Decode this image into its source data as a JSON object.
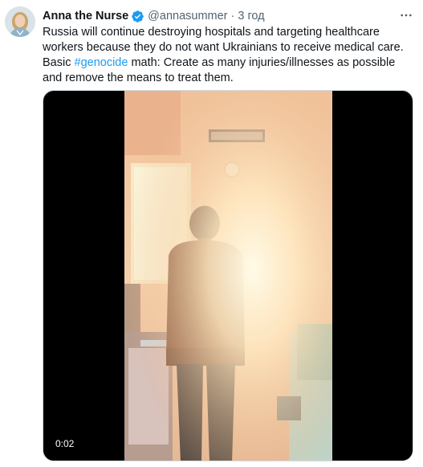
{
  "author": {
    "display_name": "Anna the Nurse",
    "handle": "@annasummer",
    "separator": "·",
    "time": "3 год"
  },
  "icons": {
    "avatar": "avatar-photo",
    "verified": "verified-badge-icon",
    "more": "more-dots-icon"
  },
  "colors": {
    "accent": "#1d9bf0",
    "text": "#0f1419",
    "muted": "#536471"
  },
  "tweet": {
    "text_before": "Russia will continue destroying hospitals and targeting healthcare workers because they do not want Ukrainians to receive medical care. Basic ",
    "hashtag": "#genocide",
    "text_after": " math: Create as many injuries/illnesses as possible and remove the means to treat them."
  },
  "media": {
    "type": "video",
    "duration": "0:02"
  }
}
